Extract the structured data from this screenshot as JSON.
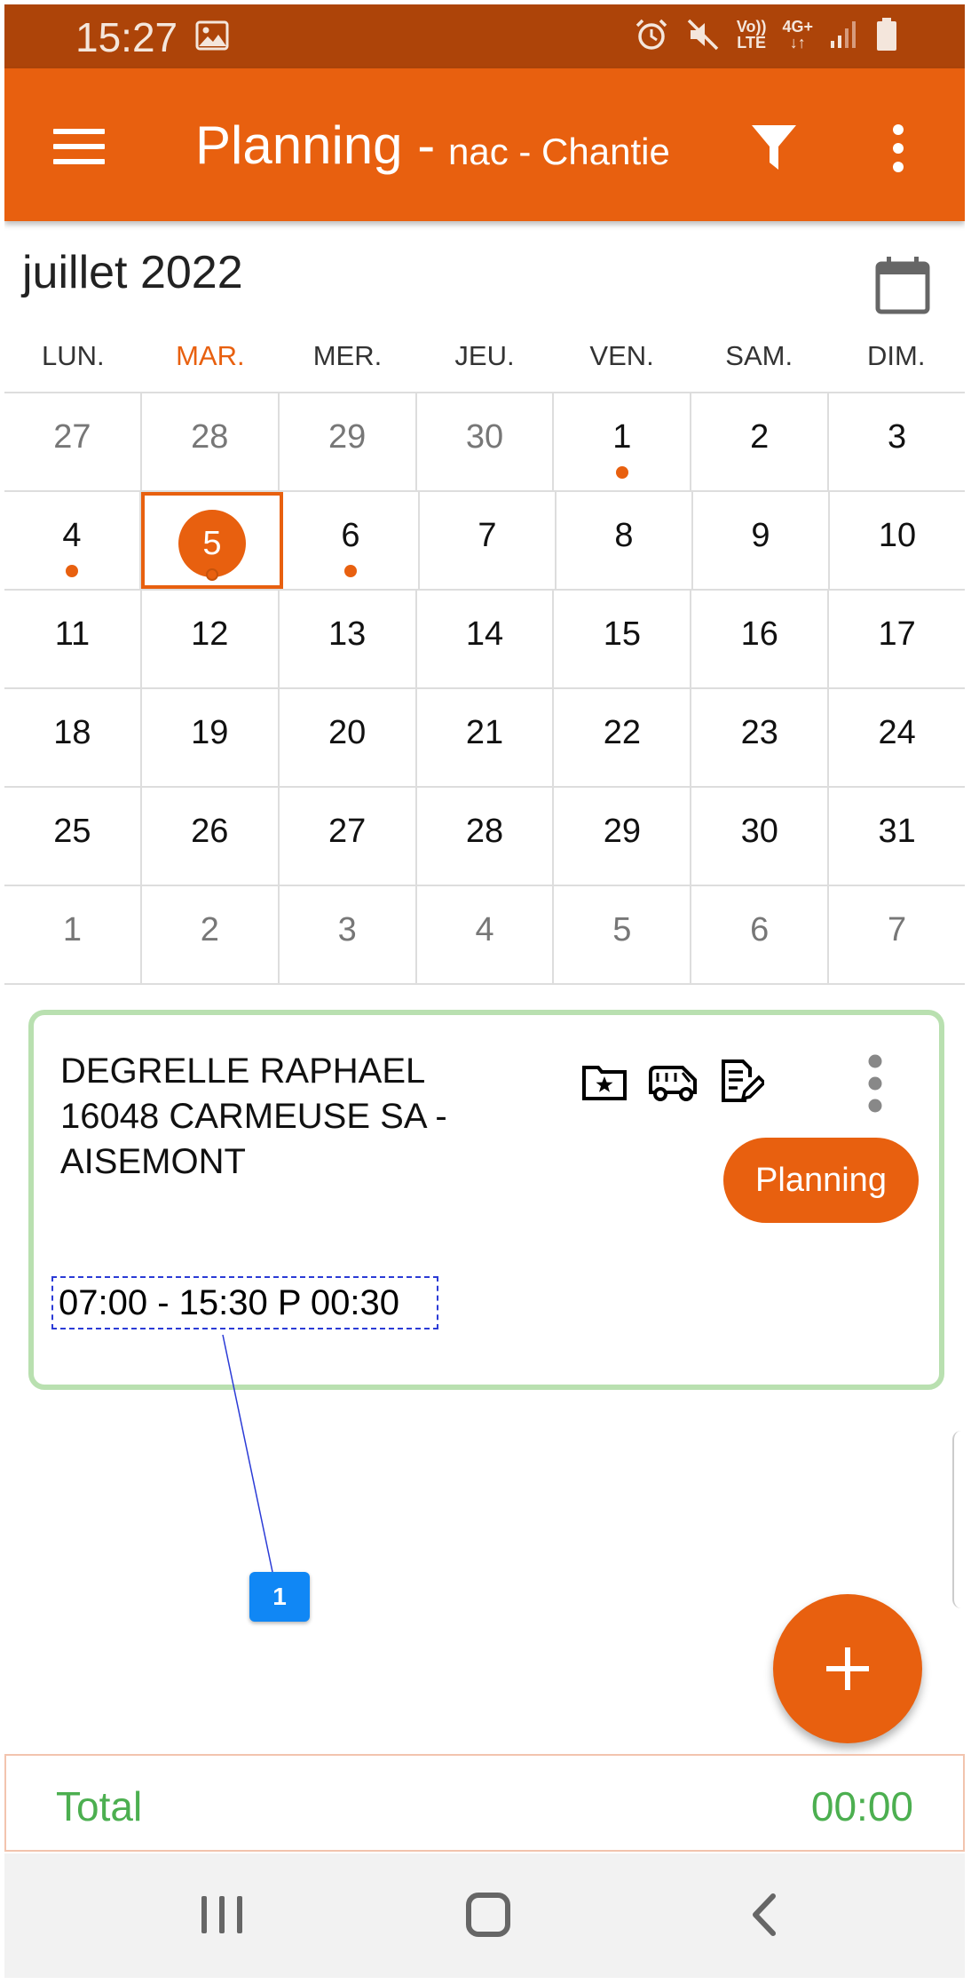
{
  "status_bar": {
    "time": "15:27",
    "icons": [
      "image-icon",
      "alarm-icon",
      "mute-icon",
      "volte-icon",
      "4g-icon",
      "signal-icon",
      "battery-icon"
    ],
    "volte_label_1": "Vo))",
    "volte_label_2": "LTE",
    "net_label": "4G+"
  },
  "toolbar": {
    "title": "Planning -",
    "subtitle": "nac - Chantie",
    "menu_icon": "hamburger-menu-icon",
    "filter_icon": "filter-icon",
    "more_icon": "more-vert-icon"
  },
  "calendar": {
    "month_label": "juillet 2022",
    "weekdays": [
      "LUN.",
      "MAR.",
      "MER.",
      "JEU.",
      "VEN.",
      "SAM.",
      "DIM."
    ],
    "weeks": [
      [
        "27",
        "28",
        "29",
        "30",
        "1",
        "2",
        "3"
      ],
      [
        "4",
        "5",
        "6",
        "7",
        "8",
        "9",
        "10"
      ],
      [
        "11",
        "12",
        "13",
        "14",
        "15",
        "16",
        "17"
      ],
      [
        "18",
        "19",
        "20",
        "21",
        "22",
        "23",
        "24"
      ],
      [
        "25",
        "26",
        "27",
        "28",
        "29",
        "30",
        "31"
      ],
      [
        "1",
        "2",
        "3",
        "4",
        "5",
        "6",
        "7"
      ]
    ],
    "selected_day": "5"
  },
  "card": {
    "line1": "DEGRELLE RAPHAEL",
    "line2": "16048 CARMEUSE SA -",
    "line3": "AISEMONT",
    "button_label": "Planning",
    "hours": "07:00 - 15:30 P 00:30",
    "icons": [
      "folder-star-icon",
      "van-icon",
      "edit-document-icon",
      "more-vert-icon"
    ]
  },
  "annotation": {
    "marker_label": "1"
  },
  "total": {
    "label": "Total",
    "value": "00:00"
  },
  "colors": {
    "accent": "#E8600F",
    "status_bar": "#AD4409",
    "card_border": "#B9E0B0",
    "total_text": "#4CAF50"
  }
}
